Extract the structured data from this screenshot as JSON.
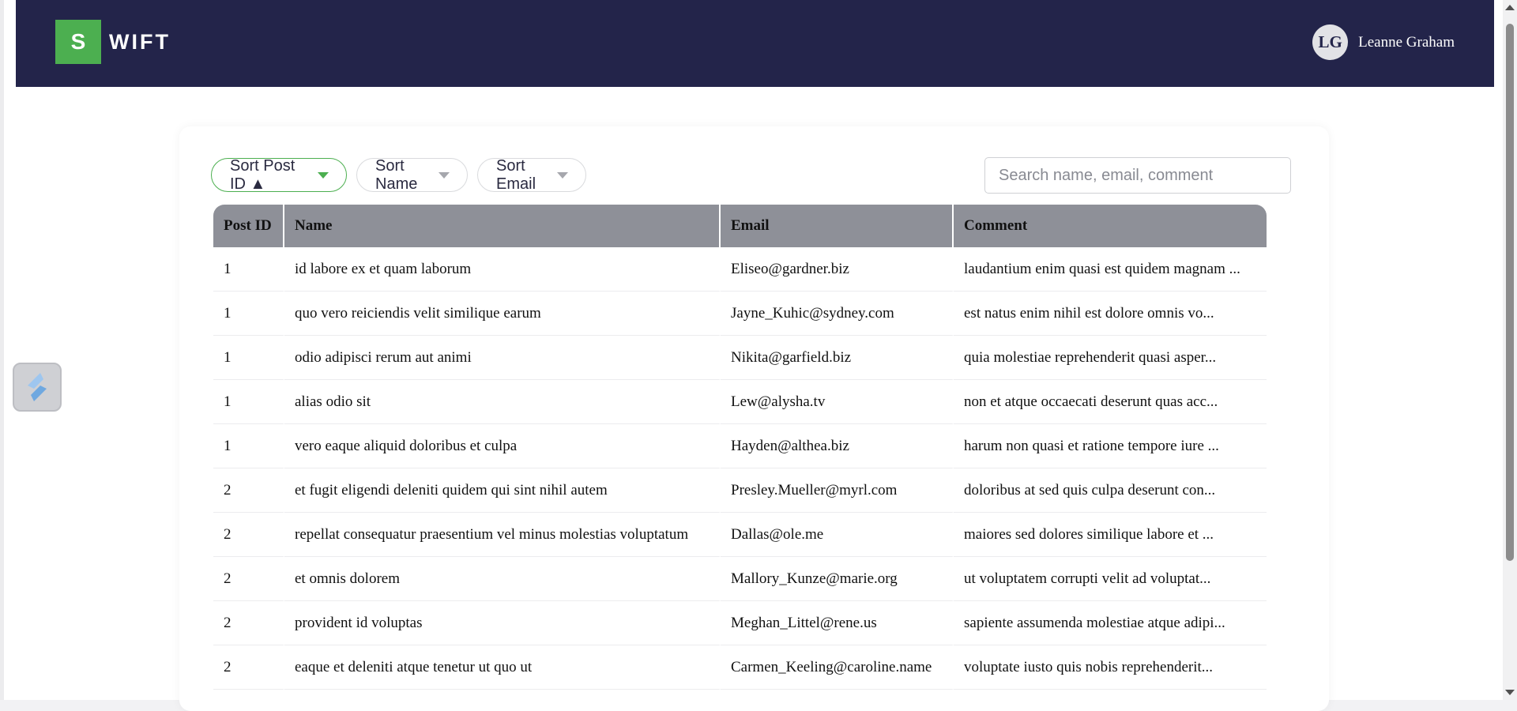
{
  "header": {
    "logo_letter": "S",
    "logo_text": "WIFT",
    "user_initials": "LG",
    "user_name": "Leanne Graham"
  },
  "toolbar": {
    "sort_post_id": "Sort Post ID ▲",
    "sort_name": "Sort Name",
    "sort_email": "Sort Email",
    "search_placeholder": "Search name, email, comment"
  },
  "table": {
    "columns": [
      "Post ID",
      "Name",
      "Email",
      "Comment"
    ],
    "rows": [
      {
        "post_id": "1",
        "name": "id labore ex et quam laborum",
        "email": "Eliseo@gardner.biz",
        "comment": "laudantium enim quasi est quidem magnam ..."
      },
      {
        "post_id": "1",
        "name": "quo vero reiciendis velit similique earum",
        "email": "Jayne_Kuhic@sydney.com",
        "comment": "est natus enim nihil est dolore omnis vo..."
      },
      {
        "post_id": "1",
        "name": "odio adipisci rerum aut animi",
        "email": "Nikita@garfield.biz",
        "comment": "quia molestiae reprehenderit quasi asper..."
      },
      {
        "post_id": "1",
        "name": "alias odio sit",
        "email": "Lew@alysha.tv",
        "comment": "non et atque occaecati deserunt quas acc..."
      },
      {
        "post_id": "1",
        "name": "vero eaque aliquid doloribus et culpa",
        "email": "Hayden@althea.biz",
        "comment": "harum non quasi et ratione tempore iure ..."
      },
      {
        "post_id": "2",
        "name": "et fugit eligendi deleniti quidem qui sint nihil autem",
        "email": "Presley.Mueller@myrl.com",
        "comment": "doloribus at sed quis culpa deserunt con..."
      },
      {
        "post_id": "2",
        "name": "repellat consequatur praesentium vel minus molestias voluptatum",
        "email": "Dallas@ole.me",
        "comment": "maiores sed dolores similique labore et ..."
      },
      {
        "post_id": "2",
        "name": "et omnis dolorem",
        "email": "Mallory_Kunze@marie.org",
        "comment": "ut voluptatem corrupti velit ad voluptat..."
      },
      {
        "post_id": "2",
        "name": "provident id voluptas",
        "email": "Meghan_Littel@rene.us",
        "comment": "sapiente assumenda molestiae atque adipi..."
      },
      {
        "post_id": "2",
        "name": "eaque et deleniti atque tenetur ut quo ut",
        "email": "Carmen_Keeling@caroline.name",
        "comment": "voluptate iusto quis nobis reprehenderit..."
      }
    ]
  },
  "colors": {
    "header_bg": "#23244a",
    "accent": "#4caf50",
    "table_header_bg": "#8e9098"
  }
}
